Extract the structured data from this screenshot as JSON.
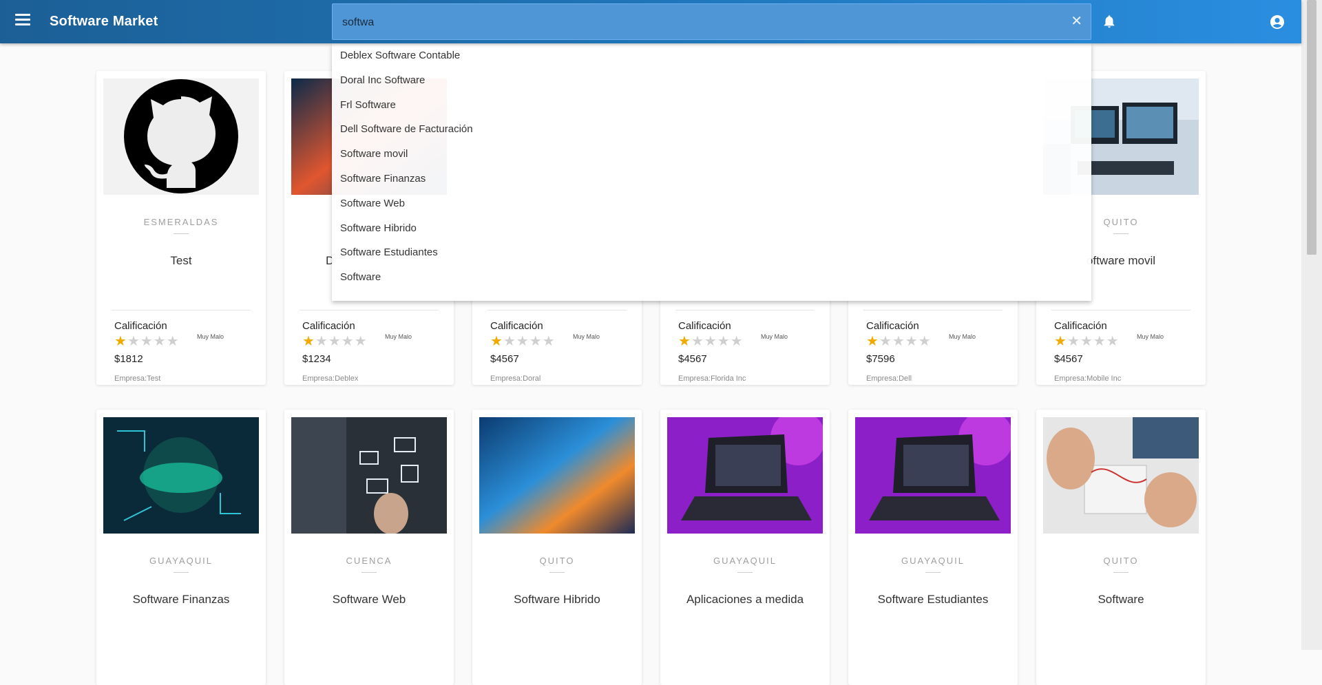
{
  "app": {
    "title": "Software Market"
  },
  "search": {
    "value": "softwa",
    "clear_icon": "✕"
  },
  "colors": {
    "appbar_start": "#1c5f96",
    "appbar_end": "#2a8ee0",
    "star_on": "#f2a900",
    "star_off": "#cfcfcf"
  },
  "icons": {
    "menu": "menu-icon",
    "clear": "close-icon",
    "notifications": "bell-icon",
    "account": "account-circle-icon"
  },
  "suggestions": [
    "Deblex Software Contable",
    "Doral Inc Software",
    "Frl Software",
    "Dell Software de Facturación",
    "Software movil",
    "Software Finanzas",
    "Software Web",
    "Software Hibrido",
    "Software Estudiantes",
    "Software"
  ],
  "rating_label": "Calificación",
  "quality_label": "Muy Malo",
  "cards_row1": [
    {
      "city": "ESMERALDAS",
      "name": "Test",
      "stars": 1,
      "price": "$1812",
      "company": "Empresa:Test",
      "image": "github-logo"
    },
    {
      "city": "",
      "name": "D",
      "stars": 1,
      "price": "$1234",
      "company": "Empresa:Deblex",
      "image": "tech-glow"
    },
    {
      "city": "",
      "name": "",
      "stars": 1,
      "price": "$4567",
      "company": "Empresa:Doral",
      "image": ""
    },
    {
      "city": "",
      "name": "",
      "stars": 1,
      "price": "$4567",
      "company": "Empresa:Florida Inc",
      "image": ""
    },
    {
      "city": "",
      "name": "",
      "stars": 1,
      "price": "$7596",
      "company": "Empresa:Dell",
      "image": ""
    },
    {
      "city": "QUITO",
      "name": "oftware movil",
      "stars": 1,
      "price": "$4567",
      "company": "Empresa:Mobile Inc",
      "image": "office-monitors"
    }
  ],
  "cards_row2": [
    {
      "city": "GUAYAQUIL",
      "name": "Software Finanzas",
      "image": "geek-circuit"
    },
    {
      "city": "CUENCA",
      "name": "Software Web",
      "image": "touch-screen"
    },
    {
      "city": "QUITO",
      "name": "Software Hibrido",
      "image": "abstract-tech"
    },
    {
      "city": "GUAYAQUIL",
      "name": "Aplicaciones a medida",
      "image": "laptop-purple"
    },
    {
      "city": "GUAYAQUIL",
      "name": "Software Estudiantes",
      "image": "laptop-purple"
    },
    {
      "city": "QUITO",
      "name": "Software",
      "image": "electronics-hands"
    }
  ]
}
